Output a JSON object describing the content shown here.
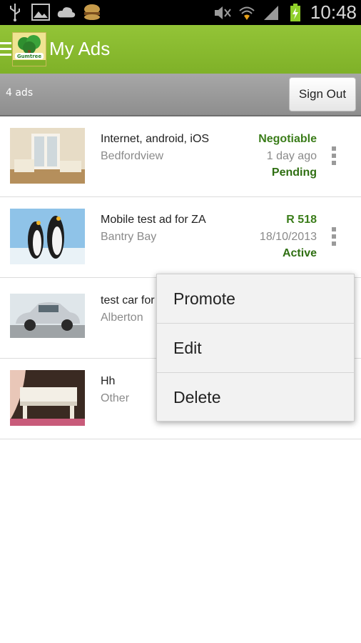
{
  "status_bar": {
    "time": "10:48",
    "icons": [
      "usb-icon",
      "image-icon",
      "cloud-icon",
      "burger-icon",
      "mute-icon",
      "wifi-icon",
      "signal-icon",
      "battery-charging-icon"
    ]
  },
  "app_bar": {
    "title": "My Ads",
    "logo_text": "Gumtree"
  },
  "sub_bar": {
    "ads_count": "4 ads",
    "sign_out_label": "Sign Out"
  },
  "ads": [
    {
      "title": "Internet, android, iOS",
      "location": "Bedfordview",
      "price": "Negotiable",
      "date": "1 day ago",
      "status": "Pending"
    },
    {
      "title": "Mobile test ad for ZA",
      "location": "Bantry Bay",
      "price": "R 518",
      "date": "18/10/2013",
      "status": "Active"
    },
    {
      "title": "test car for",
      "location": "Alberton",
      "price": "",
      "date": "",
      "status": ""
    },
    {
      "title": "Hh",
      "location": "Other",
      "price": "",
      "date": "",
      "status": ""
    }
  ],
  "context_menu": {
    "items": [
      "Promote",
      "Edit",
      "Delete"
    ]
  },
  "colors": {
    "accent": "#8cbf33",
    "price_green": "#3b7d1a"
  }
}
